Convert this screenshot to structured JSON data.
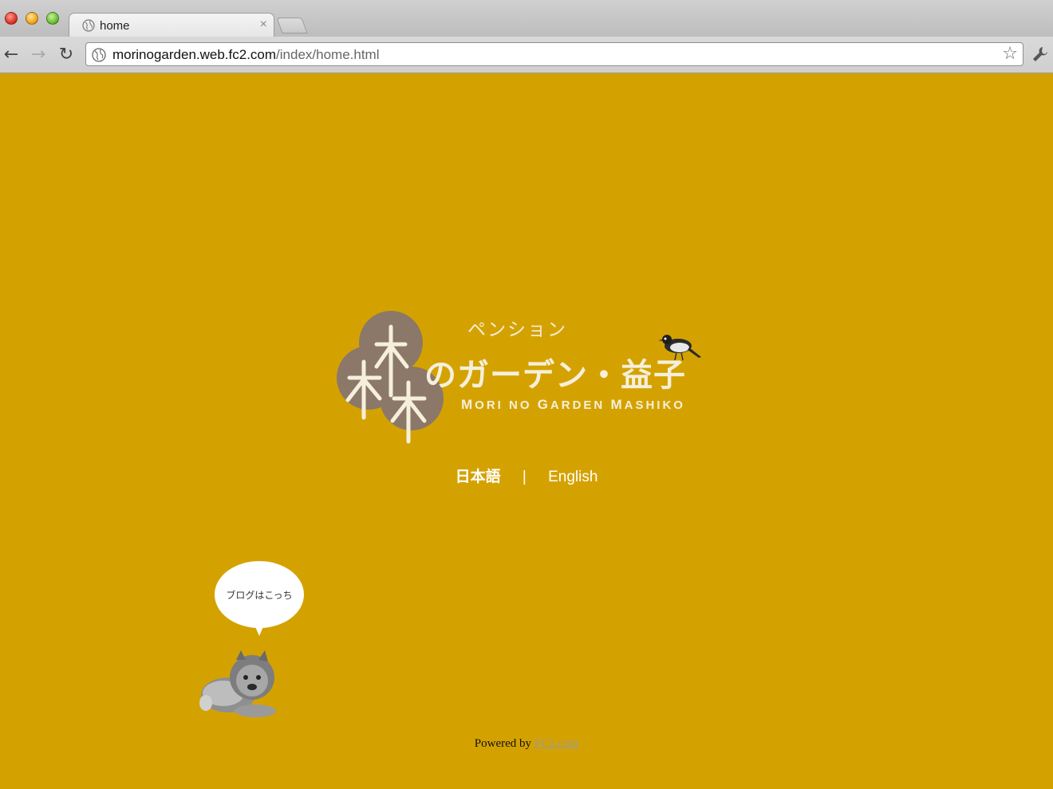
{
  "browser": {
    "tab_title": "home",
    "tab_close": "×",
    "url_host": "morinogarden.web.fc2.com",
    "url_path": "/index/home.html",
    "back_glyph": "←",
    "forward_glyph": "→",
    "reload_glyph": "↻",
    "star_glyph": "☆",
    "icons": [
      "globe-icon",
      "close-icon",
      "back-arrow-icon",
      "forward-arrow-icon",
      "reload-icon",
      "star-icon",
      "wrench-icon"
    ]
  },
  "logo": {
    "subtitle": "ペンション",
    "title": "のガーデン・益子",
    "roman_parts": [
      {
        "big": "M",
        "small": "ORI"
      },
      {
        "big": "",
        "small": "NO"
      },
      {
        "big": "G",
        "small": "ARDEN"
      },
      {
        "big": "M",
        "small": "ASHIKO"
      }
    ],
    "tree_color": "#8b7868",
    "text_color": "#f6efdb"
  },
  "languages": {
    "japanese": "日本語",
    "separator": "|",
    "english": "English"
  },
  "blog": {
    "bubble_text": "ブログはこっち"
  },
  "footer": {
    "powered_by": "Powered by",
    "link_text": "FC2.com"
  },
  "colors": {
    "page_background": "#d4a200",
    "bubble": "#ffffff",
    "footer_link": "#9a9a9a"
  }
}
